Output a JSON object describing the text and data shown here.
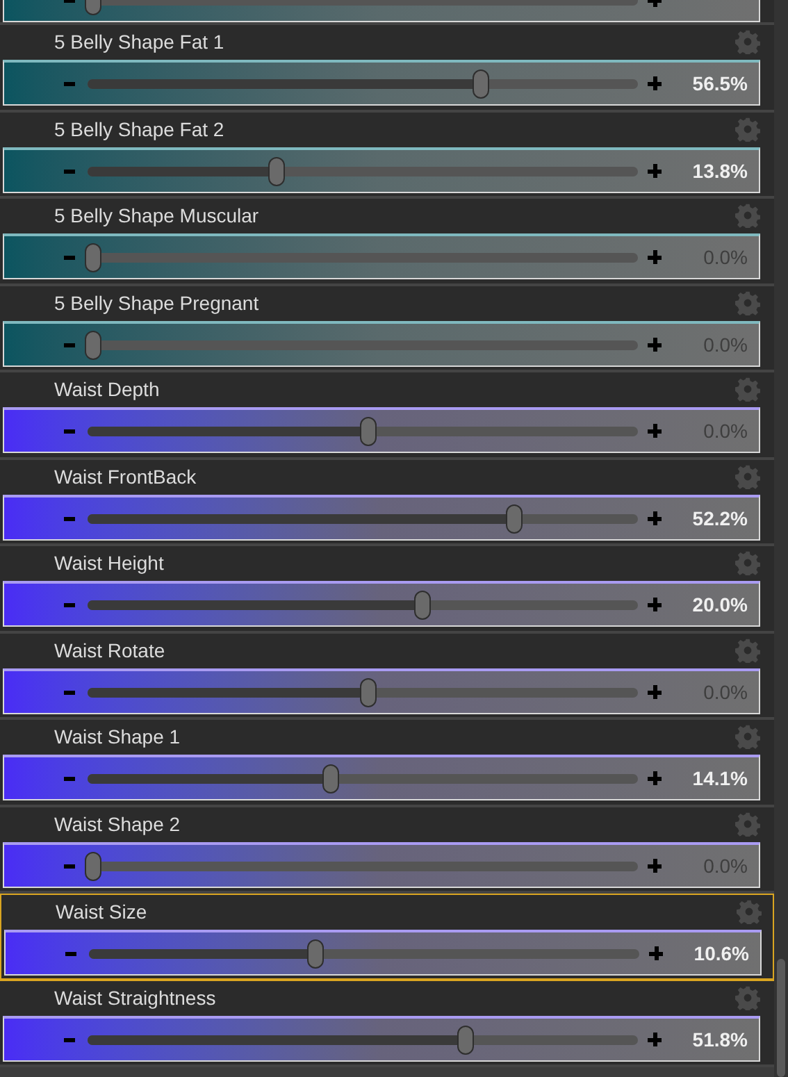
{
  "partial_top": {
    "kind": "teal",
    "level": 0
  },
  "parameters": [
    {
      "label": "5 Belly Shape Fat 1",
      "kind": "teal",
      "level": 0.72,
      "value": "56.5%",
      "default": false,
      "selected": false
    },
    {
      "label": "5 Belly Shape Fat 2",
      "kind": "teal",
      "level": 0.34,
      "value": "13.8%",
      "default": false,
      "selected": false
    },
    {
      "label": "5 Belly Shape Muscular",
      "kind": "teal",
      "level": 0,
      "value": "0.0%",
      "default": true,
      "selected": false
    },
    {
      "label": "5 Belly Shape Pregnant",
      "kind": "teal",
      "level": 0,
      "value": "0.0%",
      "default": true,
      "selected": false
    },
    {
      "label": "Waist Depth",
      "kind": "purple",
      "level": 0.51,
      "value": "0.0%",
      "default": true,
      "selected": false
    },
    {
      "label": "Waist FrontBack",
      "kind": "purple",
      "level": 0.78,
      "value": "52.2%",
      "default": false,
      "selected": false
    },
    {
      "label": "Waist Height",
      "kind": "purple",
      "level": 0.61,
      "value": "20.0%",
      "default": false,
      "selected": false
    },
    {
      "label": "Waist Rotate",
      "kind": "purple",
      "level": 0.51,
      "value": "0.0%",
      "default": true,
      "selected": false
    },
    {
      "label": "Waist Shape 1",
      "kind": "purple",
      "level": 0.44,
      "value": "14.1%",
      "default": false,
      "selected": false
    },
    {
      "label": "Waist Shape 2",
      "kind": "purple",
      "level": 0,
      "value": "0.0%",
      "default": true,
      "selected": false
    },
    {
      "label": "Waist Size",
      "kind": "purple",
      "level": 0.41,
      "value": "10.6%",
      "default": false,
      "selected": true
    },
    {
      "label": "Waist Straightness",
      "kind": "purple",
      "level": 0.69,
      "value": "51.8%",
      "default": false,
      "selected": false
    }
  ]
}
